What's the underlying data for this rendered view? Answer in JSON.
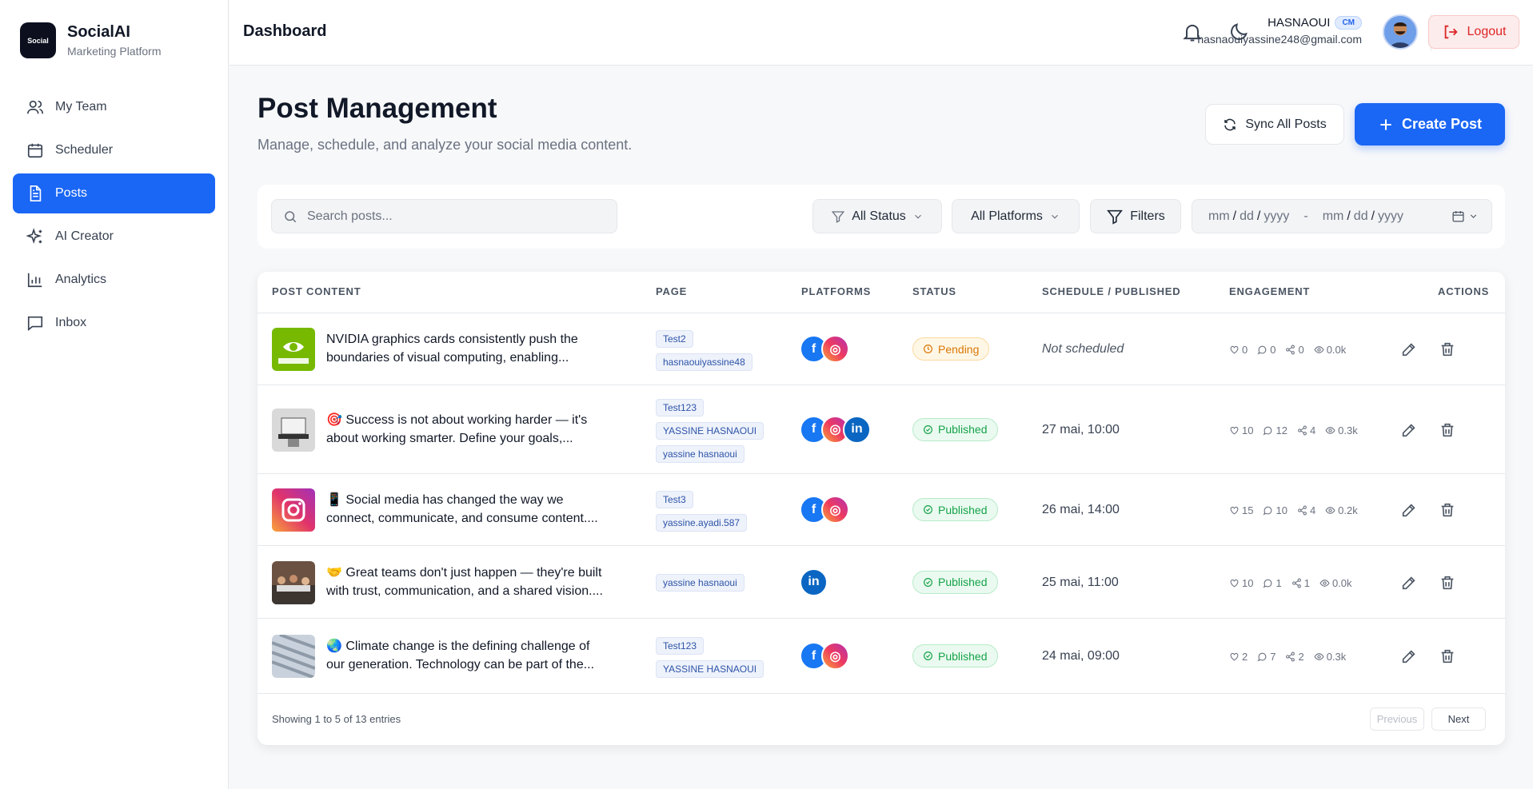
{
  "brand": {
    "name": "SocialAI",
    "subtitle": "Marketing Platform",
    "logo_text": "Social"
  },
  "sidebar": {
    "items": [
      {
        "label": "My Team",
        "icon": "users-icon"
      },
      {
        "label": "Scheduler",
        "icon": "calendar-icon"
      },
      {
        "label": "Posts",
        "icon": "document-icon",
        "active": true
      },
      {
        "label": "AI Creator",
        "icon": "sparkles-icon"
      },
      {
        "label": "Analytics",
        "icon": "bar-chart-icon"
      },
      {
        "label": "Inbox",
        "icon": "message-icon"
      }
    ]
  },
  "header": {
    "title": "Dashboard",
    "user_name": "HASNAOUI",
    "role": "CM",
    "email": "hasnaouiyassine248@gmail.com",
    "logout_label": "Logout"
  },
  "page": {
    "title": "Post Management",
    "subtitle": "Manage, schedule, and analyze your social media content.",
    "sync_label": "Sync All Posts",
    "create_label": "Create Post"
  },
  "filters": {
    "search_placeholder": "Search posts...",
    "status_label": "All Status",
    "platforms_label": "All Platforms",
    "filters_label": "Filters",
    "date_from": {
      "mm": "mm",
      "dd": "dd",
      "yyyy": "yyyy"
    },
    "date_to": {
      "mm": "mm",
      "dd": "dd",
      "yyyy": "yyyy"
    },
    "date_separator": "-"
  },
  "table": {
    "headers": [
      "POST CONTENT",
      "PAGE",
      "PLATFORMS",
      "STATUS",
      "SCHEDULE / PUBLISHED",
      "ENGAGEMENT",
      "ACTIONS"
    ],
    "rows": [
      {
        "thumb": "nvidia",
        "text_line1": "NVIDIA graphics cards consistently push the",
        "text_line2": "boundaries of visual computing, enabling...",
        "pages": [
          "Test2",
          "hasnaouiyassine48"
        ],
        "platforms": [
          "facebook",
          "instagram"
        ],
        "status": "Pending",
        "schedule": "Not scheduled",
        "likes": "0",
        "comments": "0",
        "shares": "0",
        "views": "0.0k"
      },
      {
        "thumb": "laptop",
        "text_line1": "🎯 Success is not about working harder — it's",
        "text_line2": "about working smarter. Define your goals,...",
        "pages": [
          "Test123",
          "YASSINE HASNAOUI",
          "yassine hasnaoui"
        ],
        "platforms": [
          "facebook",
          "instagram",
          "linkedin"
        ],
        "status": "Published",
        "schedule": "27 mai, 10:00",
        "likes": "10",
        "comments": "12",
        "shares": "4",
        "views": "0.3k"
      },
      {
        "thumb": "instagram",
        "text_line1": "📱 Social media has changed the way we",
        "text_line2": "connect, communicate, and consume content....",
        "pages": [
          "Test3",
          "yassine.ayadi.587"
        ],
        "platforms": [
          "facebook",
          "instagram"
        ],
        "status": "Published",
        "schedule": "26 mai, 14:00",
        "likes": "15",
        "comments": "10",
        "shares": "4",
        "views": "0.2k"
      },
      {
        "thumb": "team",
        "text_line1": "🤝 Great teams don't just happen — they're built",
        "text_line2": "with trust, communication, and a shared vision....",
        "pages": [
          "yassine hasnaoui"
        ],
        "platforms": [
          "linkedin"
        ],
        "status": "Published",
        "schedule": "25 mai, 11:00",
        "likes": "10",
        "comments": "1",
        "shares": "1",
        "views": "0.0k"
      },
      {
        "thumb": "climate",
        "text_line1": "🌏 Climate change is the defining challenge of",
        "text_line2": "our generation. Technology can be part of the...",
        "pages": [
          "Test123",
          "YASSINE HASNAOUI"
        ],
        "platforms": [
          "facebook",
          "instagram"
        ],
        "status": "Published",
        "schedule": "24 mai, 09:00",
        "likes": "2",
        "comments": "7",
        "shares": "2",
        "views": "0.3k"
      }
    ]
  },
  "pagination": {
    "showing": "Showing 1 to 5 of 13 entries",
    "previous": "Previous",
    "next": "Next"
  },
  "colors": {
    "accent": "#1a66f5",
    "pending": "#d97706",
    "published": "#16a34a",
    "danger": "#dc2626"
  }
}
